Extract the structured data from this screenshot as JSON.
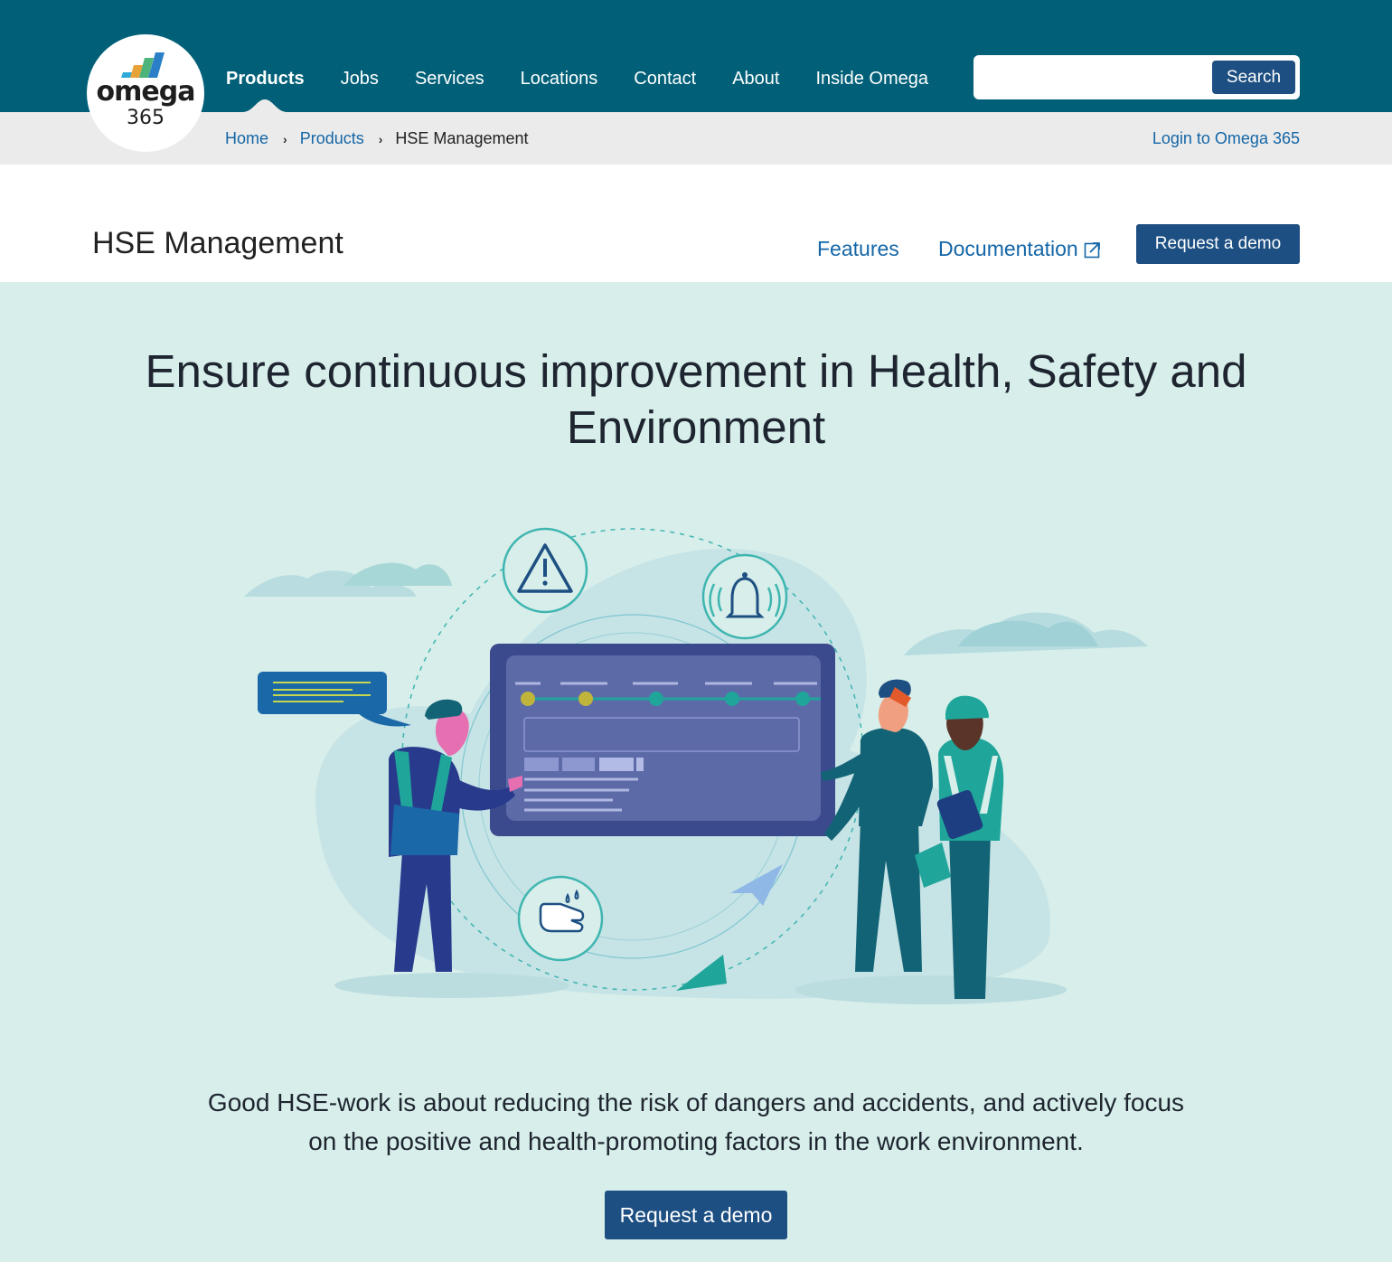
{
  "brand": {
    "word": "omega",
    "number": "365"
  },
  "nav": {
    "items": [
      "Products",
      "Jobs",
      "Services",
      "Locations",
      "Contact",
      "About",
      "Inside Omega"
    ],
    "active": "Products"
  },
  "search": {
    "value": "",
    "button_label": "Search"
  },
  "breadcrumb": {
    "home": "Home",
    "products": "Products",
    "current": "HSE Management"
  },
  "login_link": "Login to Omega 365",
  "product": {
    "title": "HSE Management",
    "features_link": "Features",
    "documentation_link": "Documentation",
    "demo_button": "Request a demo"
  },
  "hero": {
    "title": "Ensure continuous improvement in Health, Safety and Environment",
    "text": "Good HSE-work is about reducing the risk of dangers and accidents, and actively focus on the positive and health-promoting factors in the work environment.",
    "demo_button": "Request a demo"
  },
  "colors": {
    "topbar": "#016078",
    "primary_button": "#1d4f82",
    "link": "#1466a7",
    "hero_bg": "#d7eeea"
  }
}
